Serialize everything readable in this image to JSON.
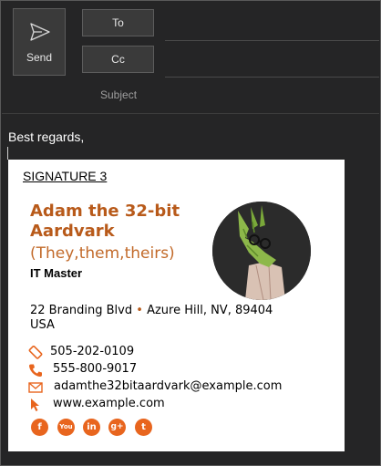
{
  "toolbar": {
    "send_label": "Send",
    "to_label": "To",
    "cc_label": "Cc",
    "subject_label": "Subject"
  },
  "body": {
    "greeting": "Best regards,"
  },
  "signature": {
    "heading": "SIGNATURE 3",
    "name": "Adam the 32-bit Aardvark",
    "pronouns": "(They,them,theirs)",
    "role": "IT Master",
    "address_street": "22 Branding Blvd",
    "address_separator": "•",
    "address_city": "Azure Hill, NV, 89404",
    "address_country": "USA",
    "mobile": "505-202-0109",
    "phone": "555-800-9017",
    "email": "adamthe32bitaardvark@example.com",
    "website": "www.example.com",
    "social": [
      "f",
      "You",
      "in",
      "g+",
      "t"
    ]
  },
  "colors": {
    "background": "#252526",
    "accent": "#e8651e",
    "name_color": "#b85a1a"
  }
}
